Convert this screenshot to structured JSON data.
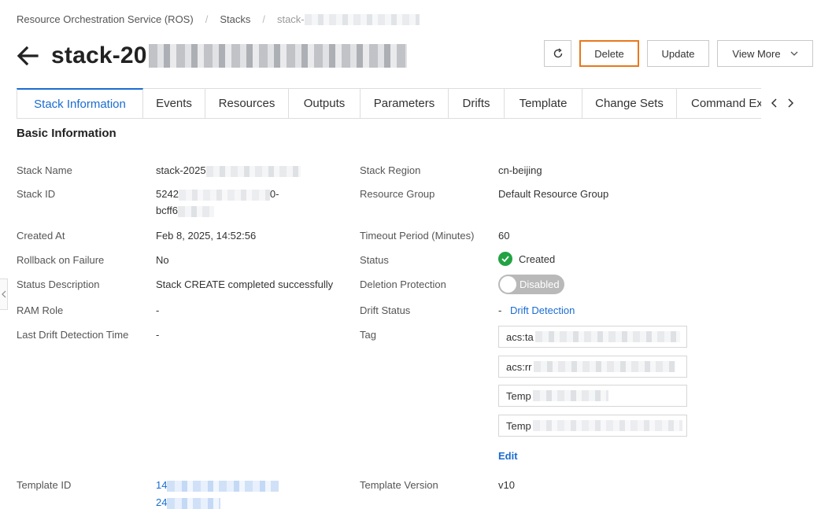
{
  "breadcrumb": {
    "items": [
      "Resource Orchestration Service (ROS)",
      "Stacks",
      "stack-"
    ]
  },
  "header": {
    "title": "stack-20",
    "back_icon": "arrow-left-icon"
  },
  "actions": {
    "refresh_icon": "refresh-icon",
    "delete_label": "Delete",
    "update_label": "Update",
    "view_more_label": "View More"
  },
  "tabs": [
    {
      "label": "Stack Information",
      "active": true
    },
    {
      "label": "Events"
    },
    {
      "label": "Resources"
    },
    {
      "label": "Outputs"
    },
    {
      "label": "Parameters"
    },
    {
      "label": "Drifts"
    },
    {
      "label": "Template"
    },
    {
      "label": "Change Sets"
    },
    {
      "label": "Command Ex"
    }
  ],
  "section": {
    "title": "Basic Information"
  },
  "info": {
    "stack_name": {
      "label": "Stack Name",
      "value": "stack-2025"
    },
    "stack_id": {
      "label": "Stack ID",
      "value_line1": "5242",
      "value_line1_suffix": "0-",
      "value_line2": "bcff6"
    },
    "created_at": {
      "label": "Created At",
      "value": "Feb 8, 2025, 14:52:56"
    },
    "rollback": {
      "label": "Rollback on Failure",
      "value": "No"
    },
    "status_desc": {
      "label": "Status Description",
      "value": "Stack CREATE completed successfully"
    },
    "ram_role": {
      "label": "RAM Role",
      "value": "-"
    },
    "last_drift": {
      "label": "Last Drift Detection Time",
      "value": "-"
    },
    "template_id": {
      "label": "Template ID",
      "value_line1": "14",
      "value_line2": "24"
    },
    "stack_region": {
      "label": "Stack Region",
      "value": "cn-beijing"
    },
    "resource_group": {
      "label": "Resource Group",
      "value": "Default Resource Group"
    },
    "timeout": {
      "label": "Timeout Period (Minutes)",
      "value": "60"
    },
    "status": {
      "label": "Status",
      "value": "Created",
      "color": "#23a244"
    },
    "deletion_protection": {
      "label": "Deletion Protection",
      "value": "Disabled"
    },
    "drift_status": {
      "label": "Drift Status",
      "value": "-",
      "link": "Drift Detection"
    },
    "tag": {
      "label": "Tag",
      "items": [
        "acs:ta",
        "acs:rr",
        "Temp",
        "Temp"
      ],
      "edit_label": "Edit"
    },
    "template_version": {
      "label": "Template Version",
      "value": "v10"
    }
  },
  "colors": {
    "accent": "#1a6cd1",
    "highlight": "#e8781d"
  }
}
